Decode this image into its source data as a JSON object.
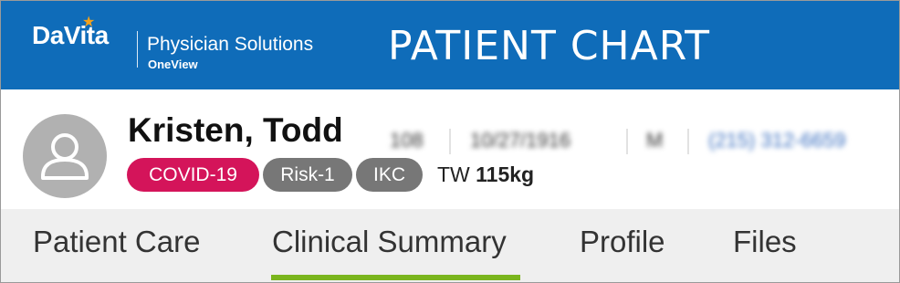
{
  "header": {
    "logo_text": "DaVita",
    "logo_line1": "Physician Solutions",
    "logo_line2": "OneView",
    "title": "PATIENT CHART",
    "colors": {
      "background": "#0f6cb9",
      "logo_star": "#f3a11b"
    }
  },
  "patient": {
    "name": "Kristen, Todd",
    "avatar_icon": "user-icon",
    "details": [
      {
        "text": "108",
        "blurred": true
      },
      {
        "text": "10/27/1916",
        "blurred": true
      },
      {
        "text": "M",
        "blurred": true
      },
      {
        "text": "(215) 312-6659",
        "blurred": true
      }
    ],
    "badges": [
      {
        "label": "COVID-19",
        "color": "#d4145a"
      },
      {
        "label": "Risk-1",
        "color": "#777777"
      },
      {
        "label": "IKC",
        "color": "#777777"
      }
    ],
    "weight_label": "TW",
    "weight_value": "115kg"
  },
  "tabs": {
    "items": [
      {
        "label": "Patient Care"
      },
      {
        "label": "Clinical Summary",
        "active": true
      },
      {
        "label": "Profile"
      },
      {
        "label": "Files"
      }
    ],
    "active_color": "#7ab51d"
  }
}
